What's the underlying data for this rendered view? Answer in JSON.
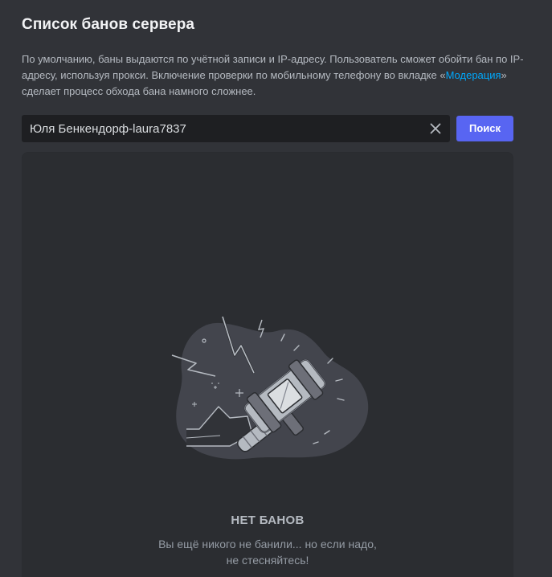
{
  "header": {
    "title": "Список банов сервера"
  },
  "description": {
    "part1": "По умолчанию, баны выдаются по учётной записи и IP-адресу. Пользователь сможет обойти бан по IP-адресу, используя прокси. Включение проверки по мобильному телефону во вкладке «",
    "link": "Модерация",
    "part2": "» сделает процесс обхода бана намного сложнее."
  },
  "search": {
    "value": "Юля Бенкендорф-laura7837",
    "button_label": "Поиск",
    "clear_icon": "close-icon"
  },
  "empty_state": {
    "illustration_icon": "ban-hammer-icon",
    "title": "НЕТ БАНОВ",
    "subtitle_line1": "Вы ещё никого не банили... но если надо,",
    "subtitle_line2": "не стесняйтесь!"
  },
  "colors": {
    "background": "#313338",
    "panel": "#2b2d31",
    "input": "#1e1f22",
    "accent": "#5865f2",
    "link": "#00a8fc"
  }
}
